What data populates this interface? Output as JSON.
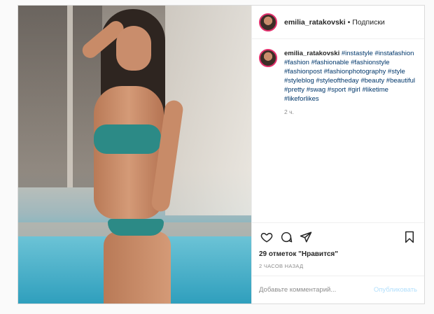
{
  "post": {
    "username": "emilia_ratakovski",
    "follow_separator": "•",
    "follow_label": "Подписки",
    "caption_username": "emilia_ratakovski",
    "hashtags": [
      "#instastyle",
      "#instafashion",
      "#fashion",
      "#fashionable",
      "#fashionstyle",
      "#fashionpost",
      "#fashionphotography",
      "#style",
      "#styleblog",
      "#styleoftheday",
      "#beauty",
      "#beautiful",
      "#pretty",
      "#swag",
      "#sport",
      "#girl",
      "#liketime",
      "#likeforlikes"
    ],
    "caption_time": "2 ч.",
    "likes": "29 отметок \"Нравится\"",
    "time_ago": "2 ЧАСОВ НАЗАД",
    "comment_placeholder": "Добавьте комментарий...",
    "publish_label": "Опубликовать"
  },
  "icons": {
    "like": "heart-icon",
    "comment": "comment-icon",
    "share": "paper-plane-icon",
    "save": "bookmark-icon"
  },
  "colors": {
    "tag": "#00376b",
    "muted": "#8e8e8e",
    "publish_disabled": "#b2dffc",
    "border": "#dbdbdb"
  }
}
